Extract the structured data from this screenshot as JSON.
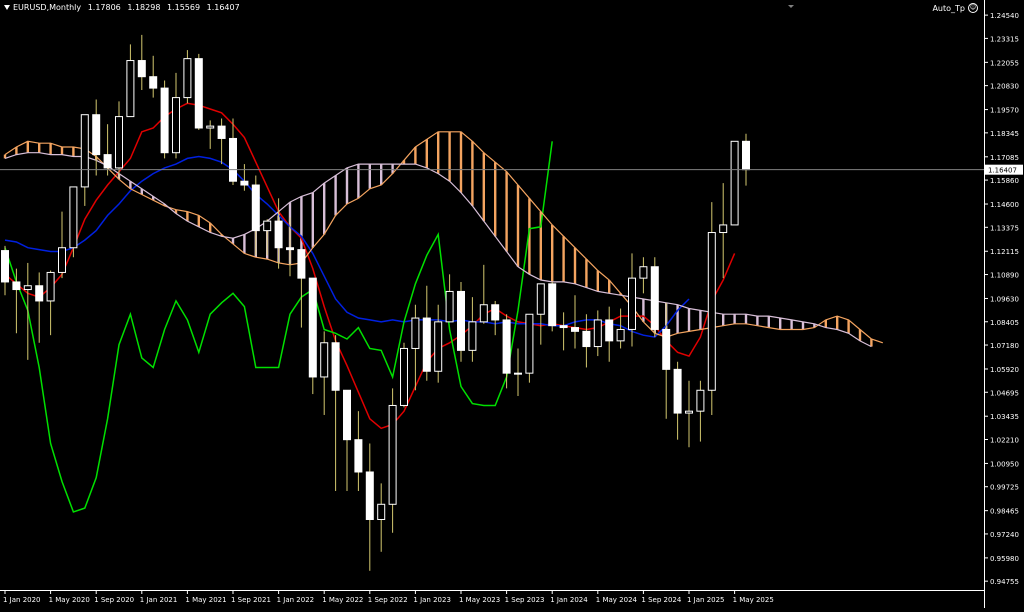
{
  "header": {
    "symbol": "EURUSD,Monthly",
    "ohlc": [
      "1.17806",
      "1.18298",
      "1.15569",
      "1.16407"
    ]
  },
  "expert": {
    "name": "Auto_Tp",
    "icon": "smiley-icon"
  },
  "colors": {
    "background": "#000000",
    "bull_candle": "#ffffff",
    "bear_candle": "#ffffff",
    "wick": "#d4c870",
    "tenkan": "#e00000",
    "kijun": "#0020e0",
    "chikou": "#00e000",
    "kumo_bull": "#f4a460",
    "kumo_bear": "#d8bfd8",
    "price_line": "#808080"
  },
  "chart_data": {
    "type": "candlestick",
    "title": "",
    "y_ticks": [
      "1.24540",
      "1.23315",
      "1.22055",
      "1.20830",
      "1.19570",
      "1.18345",
      "1.17085",
      "1.15860",
      "1.14600",
      "1.13375",
      "1.12115",
      "1.10890",
      "1.09630",
      "1.08405",
      "1.07180",
      "1.05920",
      "1.04695",
      "1.03435",
      "1.02210",
      "1.00950",
      "0.99725",
      "0.98465",
      "0.97240",
      "0.95980",
      "0.94755"
    ],
    "ylim": [
      0.9429,
      1.2502
    ],
    "current_price": "1.16407",
    "x_ticks": [
      "1 Jan 2020",
      "1 May 2020",
      "1 Sep 2020",
      "1 Jan 2021",
      "1 May 2021",
      "1 Sep 2021",
      "1 Jan 2022",
      "1 May 2022",
      "1 Sep 2022",
      "1 Jan 2023",
      "1 May 2023",
      "1 Sep 2023",
      "1 Jan 2024",
      "1 May 2024",
      "1 Sep 2024",
      "1 Jan 2025",
      "1 May 2025"
    ],
    "x_tick_month_index": [
      0,
      4,
      8,
      12,
      16,
      20,
      24,
      28,
      32,
      36,
      40,
      44,
      48,
      52,
      56,
      60,
      64
    ],
    "candles": [
      [
        1.1215,
        1.124,
        1.098,
        1.105
      ],
      [
        1.105,
        1.112,
        1.078,
        1.101
      ],
      [
        1.101,
        1.115,
        1.064,
        1.103
      ],
      [
        1.103,
        1.11,
        1.073,
        1.095
      ],
      [
        1.095,
        1.111,
        1.077,
        1.11
      ],
      [
        1.11,
        1.142,
        1.107,
        1.123
      ],
      [
        1.123,
        1.155,
        1.118,
        1.155
      ],
      [
        1.155,
        1.19,
        1.145,
        1.193
      ],
      [
        1.193,
        1.201,
        1.161,
        1.172
      ],
      [
        1.172,
        1.188,
        1.161,
        1.165
      ],
      [
        1.165,
        1.2,
        1.16,
        1.192
      ],
      [
        1.192,
        1.23,
        1.192,
        1.2215
      ],
      [
        1.2215,
        1.235,
        1.206,
        1.213
      ],
      [
        1.213,
        1.224,
        1.202,
        1.207
      ],
      [
        1.207,
        1.211,
        1.17,
        1.173
      ],
      [
        1.173,
        1.215,
        1.17,
        1.202
      ],
      [
        1.202,
        1.227,
        1.199,
        1.2225
      ],
      [
        1.2225,
        1.225,
        1.185,
        1.186
      ],
      [
        1.186,
        1.19,
        1.175,
        1.187
      ],
      [
        1.187,
        1.191,
        1.167,
        1.1805
      ],
      [
        1.1805,
        1.191,
        1.156,
        1.158
      ],
      [
        1.158,
        1.167,
        1.153,
        1.156
      ],
      [
        1.156,
        1.161,
        1.119,
        1.132
      ],
      [
        1.132,
        1.138,
        1.119,
        1.137
      ],
      [
        1.137,
        1.149,
        1.112,
        1.123
      ],
      [
        1.123,
        1.139,
        1.108,
        1.122
      ],
      [
        1.122,
        1.118,
        1.081,
        1.107
      ],
      [
        1.107,
        1.107,
        1.046,
        1.055
      ],
      [
        1.055,
        1.079,
        1.035,
        1.073
      ],
      [
        1.073,
        1.077,
        0.995,
        1.048
      ],
      [
        1.048,
        1.028,
        0.995,
        1.022
      ],
      [
        1.022,
        1.037,
        0.995,
        1.005
      ],
      [
        1.005,
        1.02,
        0.953,
        0.98
      ],
      [
        0.98,
        0.999,
        0.963,
        0.988
      ],
      [
        0.988,
        1.049,
        0.973,
        1.04
      ],
      [
        1.04,
        1.073,
        1.039,
        1.07
      ],
      [
        1.07,
        1.093,
        1.048,
        1.086
      ],
      [
        1.086,
        1.103,
        1.053,
        1.058
      ],
      [
        1.058,
        1.093,
        1.052,
        1.084
      ],
      [
        1.084,
        1.109,
        1.091,
        1.1
      ],
      [
        1.1,
        1.105,
        1.063,
        1.069
      ],
      [
        1.069,
        1.097,
        1.063,
        1.084
      ],
      [
        1.084,
        1.114,
        1.083,
        1.093
      ],
      [
        1.093,
        1.095,
        1.077,
        1.085
      ],
      [
        1.085,
        1.088,
        1.049,
        1.057
      ],
      [
        1.057,
        1.07,
        1.045,
        1.057
      ],
      [
        1.057,
        1.08,
        1.052,
        1.088
      ],
      [
        1.088,
        1.101,
        1.072,
        1.104
      ],
      [
        1.104,
        1.105,
        1.079,
        1.082
      ],
      [
        1.082,
        1.089,
        1.069,
        1.081
      ],
      [
        1.081,
        1.098,
        1.07,
        1.079
      ],
      [
        1.079,
        1.088,
        1.06,
        1.071
      ],
      [
        1.071,
        1.09,
        1.066,
        1.085
      ],
      [
        1.085,
        1.092,
        1.063,
        1.074
      ],
      [
        1.074,
        1.091,
        1.07,
        1.08
      ],
      [
        1.08,
        1.12,
        1.071,
        1.107
      ],
      [
        1.107,
        1.118,
        1.099,
        1.113
      ],
      [
        1.113,
        1.118,
        1.076,
        1.08
      ],
      [
        1.08,
        1.094,
        1.033,
        1.059
      ],
      [
        1.059,
        1.063,
        1.022,
        1.036
      ],
      [
        1.036,
        1.053,
        1.018,
        1.037
      ],
      [
        1.037,
        1.053,
        1.021,
        1.048
      ],
      [
        1.048,
        1.147,
        1.035,
        1.131
      ],
      [
        1.131,
        1.157,
        1.107,
        1.135
      ],
      [
        1.135,
        1.169,
        1.146,
        1.179
      ],
      [
        1.179,
        1.183,
        1.1557,
        1.1641
      ]
    ],
    "series": [
      {
        "name": "",
        "kind": "tenkan",
        "start_index": 0,
        "values": [
          1.109,
          1.104,
          1.099,
          1.097,
          1.102,
          1.109,
          1.123,
          1.138,
          1.148,
          1.156,
          1.163,
          1.17,
          1.184,
          1.186,
          1.192,
          1.196,
          1.199,
          1.198,
          1.196,
          1.194,
          1.188,
          1.181,
          1.168,
          1.155,
          1.142,
          1.134,
          1.128,
          1.112,
          1.092,
          1.074,
          1.061,
          1.047,
          1.033,
          1.028,
          1.03,
          1.037,
          1.05,
          1.063,
          1.07,
          1.073,
          1.077,
          1.082,
          1.088,
          1.091,
          1.087,
          1.084,
          1.083,
          1.082,
          1.083,
          1.082,
          1.081,
          1.08,
          1.081,
          1.084,
          1.087,
          1.087,
          1.087,
          1.082,
          1.074,
          1.068,
          1.066,
          1.076,
          1.095,
          1.106,
          1.12
        ]
      },
      {
        "name": "",
        "kind": "kijun",
        "start_index": 0,
        "values": [
          1.127,
          1.126,
          1.123,
          1.122,
          1.121,
          1.121,
          1.123,
          1.127,
          1.132,
          1.14,
          1.146,
          1.153,
          1.158,
          1.162,
          1.165,
          1.167,
          1.17,
          1.171,
          1.17,
          1.168,
          1.164,
          1.158,
          1.151,
          1.146,
          1.14,
          1.134,
          1.129,
          1.12,
          1.108,
          1.096,
          1.089,
          1.086,
          1.085,
          1.084,
          1.085,
          1.084,
          1.085,
          1.085,
          1.085,
          1.084,
          1.085,
          1.084,
          1.084,
          1.083,
          1.084,
          1.083,
          1.083,
          1.083,
          1.082,
          1.082,
          1.084,
          1.085,
          1.085,
          1.083,
          1.082,
          1.079,
          1.077,
          1.076,
          1.082,
          1.09,
          1.096
        ]
      },
      {
        "name": "",
        "kind": "chikou",
        "start_index": 0,
        "values": [
          1.123,
          1.105,
          1.09,
          1.06,
          1.02,
          1.0,
          0.984,
          0.986,
          1.002,
          1.033,
          1.072,
          1.088,
          1.065,
          1.06,
          1.08,
          1.095,
          1.085,
          1.068,
          1.088,
          1.094,
          1.099,
          1.092,
          1.06,
          1.06,
          1.06,
          1.088,
          1.097,
          1.101,
          1.08,
          1.078,
          1.075,
          1.081,
          1.07,
          1.069,
          1.055,
          1.084,
          1.104,
          1.119,
          1.13,
          1.08,
          1.05,
          1.041,
          1.04,
          1.04,
          1.055,
          1.09,
          1.133,
          1.134,
          1.179
        ]
      },
      {
        "name": "",
        "kind": "senkou_a",
        "start_index": 0,
        "values": [
          1.172,
          1.176,
          1.179,
          1.178,
          1.178,
          1.176,
          1.176,
          1.175,
          1.171,
          1.165,
          1.159,
          1.154,
          1.151,
          1.148,
          1.145,
          1.143,
          1.142,
          1.14,
          1.136,
          1.13,
          1.125,
          1.12,
          1.118,
          1.117,
          1.115,
          1.114,
          1.115,
          1.123,
          1.13,
          1.14,
          1.146,
          1.149,
          1.154,
          1.156,
          1.162,
          1.169,
          1.176,
          1.18,
          1.184,
          1.184,
          1.184,
          1.179,
          1.173,
          1.168,
          1.163,
          1.156,
          1.149,
          1.142,
          1.135,
          1.129,
          1.123,
          1.117,
          1.111,
          1.106,
          1.099,
          1.092,
          1.084,
          1.078,
          1.076,
          1.078,
          1.079,
          1.08,
          1.081,
          1.082,
          1.083,
          1.083,
          1.082,
          1.081,
          1.08,
          1.08,
          1.08,
          1.081,
          1.085,
          1.087,
          1.085,
          1.08,
          1.075,
          1.073
        ]
      },
      {
        "name": "",
        "kind": "senkou_b",
        "start_index": 0,
        "values": [
          1.17,
          1.172,
          1.173,
          1.173,
          1.172,
          1.172,
          1.171,
          1.171,
          1.169,
          1.166,
          1.162,
          1.158,
          1.154,
          1.15,
          1.146,
          1.141,
          1.137,
          1.134,
          1.131,
          1.129,
          1.128,
          1.13,
          1.133,
          1.137,
          1.142,
          1.147,
          1.15,
          1.152,
          1.157,
          1.161,
          1.165,
          1.167,
          1.167,
          1.167,
          1.167,
          1.167,
          1.167,
          1.165,
          1.162,
          1.158,
          1.152,
          1.145,
          1.137,
          1.129,
          1.121,
          1.113,
          1.109,
          1.106,
          1.105,
          1.105,
          1.104,
          1.102,
          1.1,
          1.099,
          1.098,
          1.097,
          1.096,
          1.095,
          1.094,
          1.093,
          1.091,
          1.09,
          1.089,
          1.088,
          1.088,
          1.088,
          1.087,
          1.087,
          1.086,
          1.085,
          1.084,
          1.083,
          1.081,
          1.08,
          1.078,
          1.074,
          1.071
        ]
      }
    ]
  }
}
